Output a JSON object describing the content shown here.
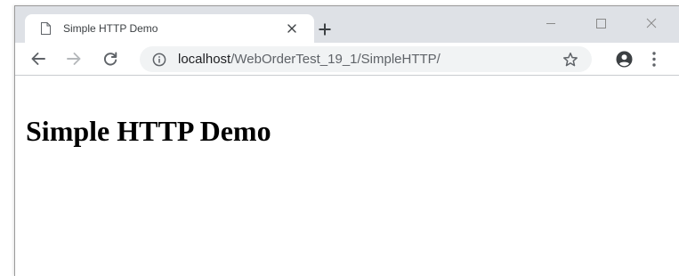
{
  "browser": {
    "tab": {
      "title": "Simple HTTP Demo",
      "favicon_icon": "page-icon",
      "close_icon": "close-icon"
    },
    "new_tab_icon": "plus-icon",
    "window_controls": [
      "minimize-icon",
      "maximize-icon",
      "close-icon"
    ],
    "toolbar": {
      "back_icon": "arrow-left-icon",
      "forward_icon": "arrow-right-icon",
      "reload_icon": "reload-icon",
      "address": {
        "site_info_icon": "info-icon",
        "host": "localhost",
        "path": "/WebOrderTest_19_1/SimpleHTTP/"
      },
      "bookmark_icon": "star-icon",
      "profile_icon": "account-icon",
      "menu_icon": "more-vert-icon"
    }
  },
  "page": {
    "heading": "Simple HTTP Demo"
  },
  "colors": {
    "tabstrip": "#dee1e6",
    "omnibox": "#f1f3f4",
    "icon": "#5f6368",
    "text": "#202124"
  }
}
